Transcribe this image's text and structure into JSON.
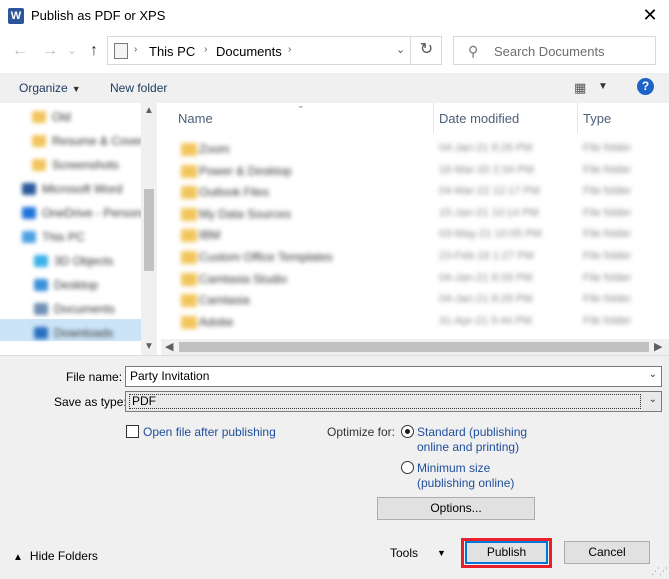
{
  "window": {
    "title": "Publish as PDF or XPS",
    "app_icon_letter": "W",
    "close_glyph": "✕"
  },
  "nav": {
    "back_glyph": "←",
    "forward_glyph": "→",
    "recent_glyph": "⌄",
    "up_glyph": "↑",
    "breadcrumbs": [
      "This PC",
      "Documents"
    ],
    "refresh_glyph": "↻",
    "search_placeholder": "Search Documents",
    "search_glyph": "⚲"
  },
  "toolbar": {
    "organize": "Organize",
    "new_folder": "New folder",
    "help": "?"
  },
  "navpane": {
    "items": [
      {
        "label": "Old",
        "icon": "folder-icon",
        "color": "#f2c55c"
      },
      {
        "label": "Resume & Cover",
        "icon": "folder-icon",
        "color": "#f2c55c"
      },
      {
        "label": "Screenshots",
        "icon": "folder-icon",
        "color": "#f2c55c"
      },
      {
        "label": "Microsoft Word",
        "icon": "word-icon",
        "color": "#2b579a"
      },
      {
        "label": "OneDrive - Personal",
        "icon": "onedrive-icon",
        "color": "#1e73d8"
      },
      {
        "label": "This PC",
        "icon": "pc-icon",
        "color": "#4ba1e0"
      },
      {
        "label": "3D Objects",
        "icon": "3d-objects-icon",
        "color": "#3ab0e8"
      },
      {
        "label": "Desktop",
        "icon": "desktop-icon",
        "color": "#3a8fd8"
      },
      {
        "label": "Documents",
        "icon": "documents-icon",
        "color": "#6f8fb3"
      },
      {
        "label": "Downloads",
        "icon": "downloads-icon",
        "color": "#2a6fc0"
      }
    ]
  },
  "filelist": {
    "columns": [
      "Name",
      "Date modified",
      "Type"
    ],
    "rows": [
      {
        "name": "Zoom",
        "date": "04-Jan-21 8:26 PM",
        "type": "File folder"
      },
      {
        "name": "Power & Desktop",
        "date": "16-Mar-20 2:34 PM",
        "type": "File folder"
      },
      {
        "name": "Outlook Files",
        "date": "04-Mar-22 12:17 PM",
        "type": "File folder"
      },
      {
        "name": "My Data Sources",
        "date": "15-Jan-21 10:14 PM",
        "type": "File folder"
      },
      {
        "name": "IBM",
        "date": "03-May-21 10:05 PM",
        "type": "File folder"
      },
      {
        "name": "Custom Office Templates",
        "date": "23-Feb-16 1:27 PM",
        "type": "File folder"
      },
      {
        "name": "Camtasia Studio",
        "date": "04-Jan-21 8:29 PM",
        "type": "File folder"
      },
      {
        "name": "Camtasia",
        "date": "04-Jan-21 8:29 PM",
        "type": "File folder"
      },
      {
        "name": "Adobe",
        "date": "31-Apr-21 5:44 PM",
        "type": "File folder"
      }
    ]
  },
  "form": {
    "file_name_label": "File name:",
    "file_name_value": "Party Invitation",
    "save_type_label": "Save as type:",
    "save_type_value": "PDF",
    "open_after_label": "Open file after publishing",
    "optimize_label": "Optimize for:",
    "standard_line1": "Standard (publishing",
    "standard_line2": "online and printing)",
    "minimum_line1": "Minimum size",
    "minimum_line2": "(publishing online)"
  },
  "buttons": {
    "options": "Options...",
    "tools": "Tools",
    "publish": "Publish",
    "cancel": "Cancel",
    "hide_folders": "Hide Folders"
  },
  "colors": {
    "highlight": "#e8202b",
    "selection": "#cce4f7",
    "link": "#1f4e9c",
    "help": "#1e64c8"
  }
}
